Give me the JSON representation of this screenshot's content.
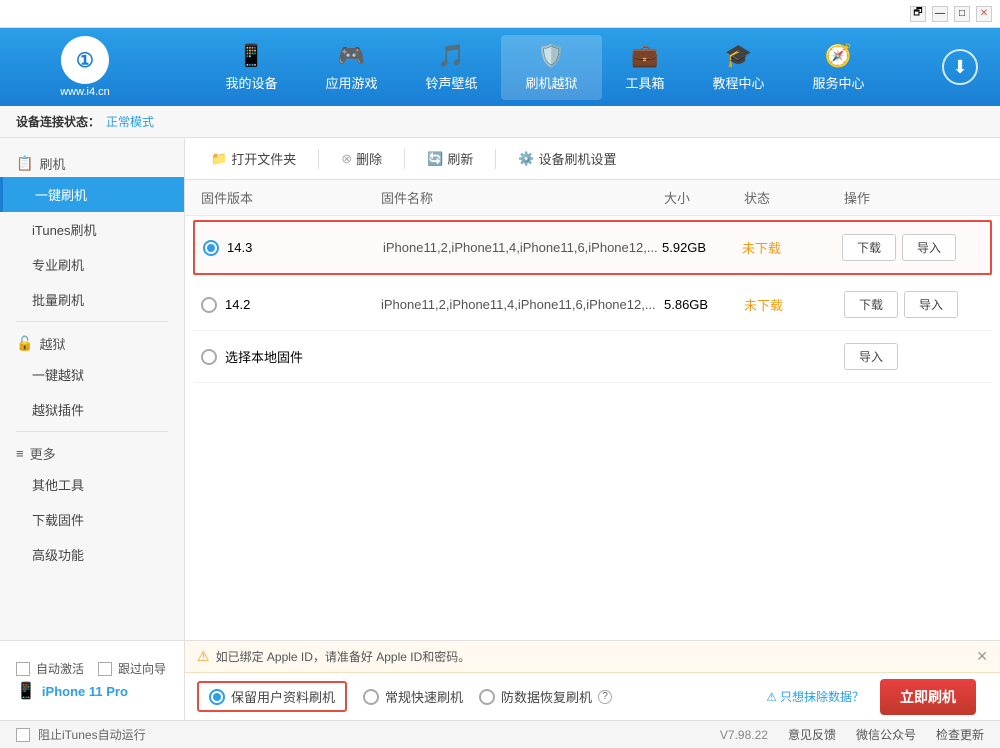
{
  "titleBar": {
    "controls": [
      "restore",
      "minimize",
      "maximize",
      "close"
    ]
  },
  "header": {
    "logo": {
      "symbol": "①",
      "text": "www.i4.cn"
    },
    "navItems": [
      {
        "id": "my-device",
        "icon": "📱",
        "label": "我的设备"
      },
      {
        "id": "app-game",
        "icon": "🎮",
        "label": "应用游戏"
      },
      {
        "id": "ringtone",
        "icon": "🎵",
        "label": "铃声壁纸"
      },
      {
        "id": "flash",
        "icon": "🛡️",
        "label": "刷机越狱",
        "active": true
      },
      {
        "id": "toolbox",
        "icon": "💼",
        "label": "工具箱"
      },
      {
        "id": "tutorial",
        "icon": "🎓",
        "label": "教程中心"
      },
      {
        "id": "service",
        "icon": "🧭",
        "label": "服务中心"
      }
    ],
    "downloadBtn": "⬇"
  },
  "statusBar": {
    "label": "设备连接状态：",
    "mode": "正常模式"
  },
  "sidebar": {
    "sections": [
      {
        "id": "flash-section",
        "icon": "📋",
        "title": "刷机",
        "items": [
          {
            "id": "one-click-flash",
            "label": "一键刷机",
            "active": true
          },
          {
            "id": "itunes-flash",
            "label": "iTunes刷机"
          },
          {
            "id": "pro-flash",
            "label": "专业刷机"
          },
          {
            "id": "batch-flash",
            "label": "批量刷机"
          }
        ]
      },
      {
        "id": "jailbreak-section",
        "icon": "🔓",
        "title": "越狱",
        "items": [
          {
            "id": "one-click-jb",
            "label": "一键越狱"
          },
          {
            "id": "jb-plugins",
            "label": "越狱插件"
          }
        ]
      },
      {
        "id": "more-section",
        "icon": "≡",
        "title": "更多",
        "items": [
          {
            "id": "other-tools",
            "label": "其他工具"
          },
          {
            "id": "download-fw",
            "label": "下载固件"
          },
          {
            "id": "advanced",
            "label": "高级功能"
          }
        ]
      }
    ]
  },
  "toolbar": {
    "openFolder": "打开文件夹",
    "delete": "删除",
    "refresh": "刷新",
    "deviceSettings": "设备刷机设置"
  },
  "tableHeader": {
    "version": "固件版本",
    "name": "固件名称",
    "size": "大小",
    "status": "状态",
    "action": "操作"
  },
  "firmwareRows": [
    {
      "id": "fw-143",
      "selected": true,
      "version": "14.3",
      "name": "iPhone11,2,iPhone11,4,iPhone11,6,iPhone12,...",
      "size": "5.92GB",
      "status": "未下载",
      "highlighted": true,
      "actions": [
        "下载",
        "导入"
      ]
    },
    {
      "id": "fw-142",
      "selected": false,
      "version": "14.2",
      "name": "iPhone11,2,iPhone11,4,iPhone11,6,iPhone12,...",
      "size": "5.86GB",
      "status": "未下载",
      "highlighted": false,
      "actions": [
        "下载",
        "导入"
      ]
    },
    {
      "id": "fw-local",
      "selected": false,
      "version": "选择本地固件",
      "name": "",
      "size": "",
      "status": "",
      "highlighted": false,
      "actions": [
        "导入"
      ]
    }
  ],
  "noticeBars": {
    "appleIdNotice": "如已绑定 Apple ID，请准备好 Apple ID和密码。",
    "noticeIcon": "⚠"
  },
  "flashOptions": {
    "options": [
      {
        "id": "keep-data",
        "label": "保留用户资料刷机",
        "selected": true
      },
      {
        "id": "quick-flash",
        "label": "常规快速刷机",
        "selected": false
      },
      {
        "id": "recovery-flash",
        "label": "防数据恢复刷机",
        "selected": false
      }
    ],
    "helpIcon": "?",
    "deleteDataLink": "只想抹除数据？",
    "flashNowBtn": "立即刷机"
  },
  "deviceInfo": {
    "autoActivate": "自动激活",
    "guideFollow": "跟过向导",
    "deviceName": "iPhone 11 Pro",
    "stopItunes": "阻止iTunes自动运行"
  },
  "appStatusBar": {
    "version": "V7.98.22",
    "feedback": "意见反馈",
    "wechat": "微信公众号",
    "checkUpdate": "检查更新"
  }
}
